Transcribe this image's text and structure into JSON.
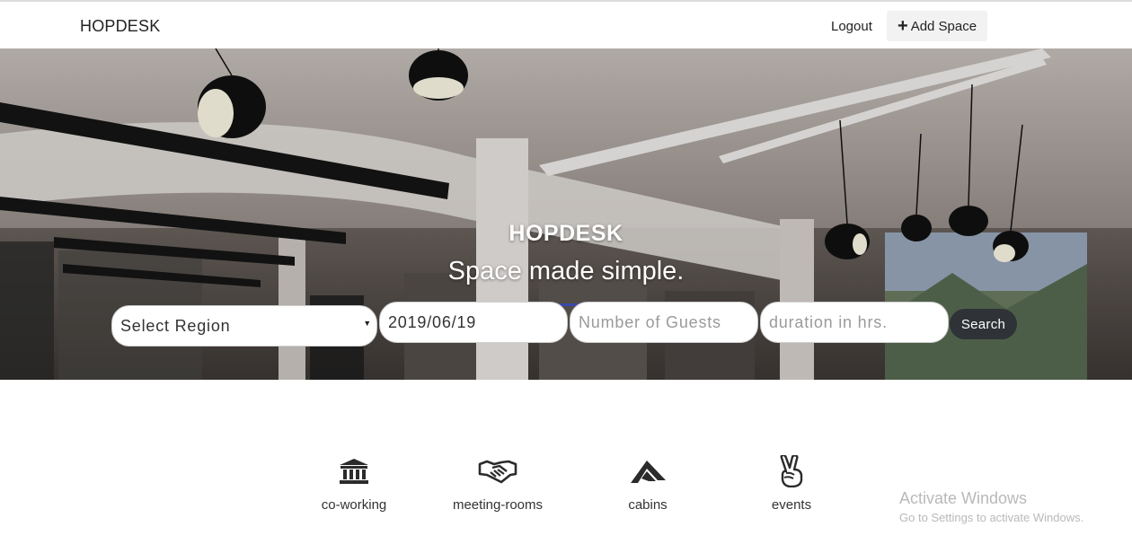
{
  "nav": {
    "brand": "HOPDESK",
    "logout": "Logout",
    "add_space": "Add Space"
  },
  "hero": {
    "title": "HOPDESK",
    "subtitle": "Space made simple.",
    "accent_color": "#3b49a8"
  },
  "search": {
    "region_value": "Select Region",
    "date_value": "2019/06/19",
    "guests_placeholder": "Number of Guests",
    "duration_placeholder": "duration in hrs.",
    "button_label": "Search"
  },
  "categories": [
    {
      "label": "co-working",
      "icon": "bank-icon"
    },
    {
      "label": "meeting-rooms",
      "icon": "handshake-icon"
    },
    {
      "label": "cabins",
      "icon": "cabin-icon"
    },
    {
      "label": "events",
      "icon": "peace-hand-icon"
    }
  ],
  "watermark": {
    "title": "Activate Windows",
    "subtitle": "Go to Settings to activate Windows."
  }
}
